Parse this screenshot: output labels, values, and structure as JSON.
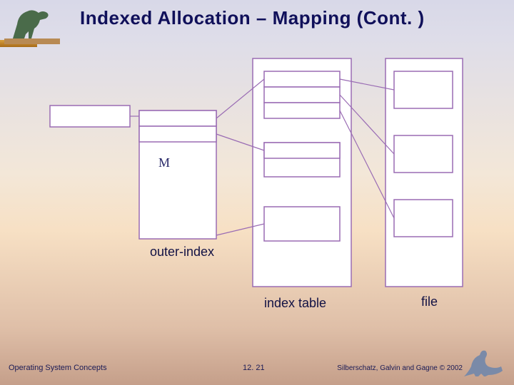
{
  "title": "Indexed Allocation – Mapping (Cont. )",
  "labels": {
    "outer_index": "outer-index",
    "index_table": "index table",
    "file": "file",
    "m_symbol": "M"
  },
  "footer": {
    "left": "Operating System Concepts",
    "page": "12. 21",
    "right": "Silberschatz, Galvin and Gagne © 2002"
  },
  "colors": {
    "box_stroke": "#9a6cb4",
    "title": "#10105a"
  }
}
